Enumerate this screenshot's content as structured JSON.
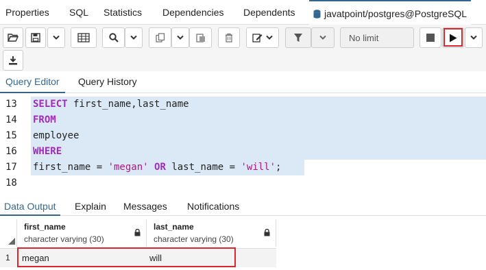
{
  "top_tabs": [
    "Properties",
    "SQL",
    "Statistics",
    "Dependencies",
    "Dependents"
  ],
  "active_tab": "javatpoint/postgres@PostgreSQL",
  "toolbar": {
    "limit_label": "No limit",
    "download_icon": "download-icon"
  },
  "query_tabs": [
    "Query Editor",
    "Query History"
  ],
  "editor": {
    "lines": [
      {
        "n": "13",
        "selected": true
      },
      {
        "n": "14",
        "selected": true
      },
      {
        "n": "15",
        "selected": true
      },
      {
        "n": "16",
        "selected": true
      },
      {
        "n": "17",
        "selected": true
      },
      {
        "n": "18",
        "selected": false
      }
    ],
    "code": {
      "l13_kw": "SELECT",
      "l13_rest": " first_name,last_name",
      "l14_kw": "FROM",
      "l15": "employee",
      "l16_kw": "WHERE",
      "l17_a": "first_name = ",
      "l17_s1": "'megan'",
      "l17_kw": " OR ",
      "l17_b": "last_name = ",
      "l17_s2": "'will'",
      "l17_c": ";"
    }
  },
  "output_tabs": [
    "Data Output",
    "Explain",
    "Messages",
    "Notifications"
  ],
  "grid": {
    "columns": [
      {
        "name": "first_name",
        "type": "character varying (30)"
      },
      {
        "name": "last_name",
        "type": "character varying (30)"
      }
    ],
    "rows": [
      {
        "num": "1",
        "cells": [
          "megan",
          "will"
        ]
      }
    ]
  },
  "colors": {
    "accent": "#326690",
    "highlight_red": "#d9252b",
    "selection": "#dbe9f7",
    "keyword": "#a02bb8",
    "string": "#b5127f"
  }
}
